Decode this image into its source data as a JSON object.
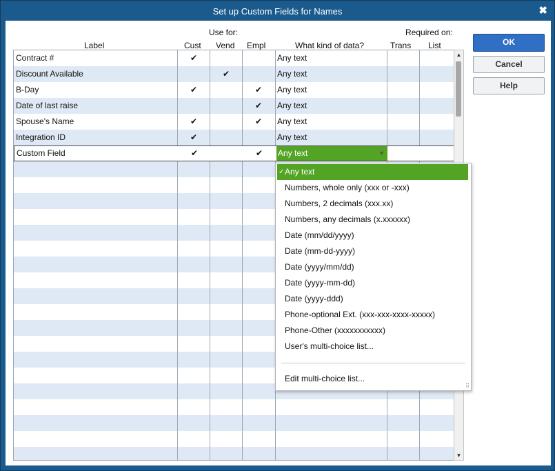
{
  "window": {
    "title": "Set up Custom Fields for Names",
    "close_glyph": "✖"
  },
  "headers": {
    "use_for": "Use for:",
    "required_on": "Required on:",
    "label": "Label",
    "cust": "Cust",
    "vend": "Vend",
    "empl": "Empl",
    "kind": "What kind of data?",
    "trans": "Trans",
    "list": "List"
  },
  "rows": [
    {
      "label": "Contract #",
      "cust": "✔",
      "vend": "",
      "empl": "",
      "kind": "Any text"
    },
    {
      "label": "Discount Available",
      "cust": "",
      "vend": "✔",
      "empl": "",
      "kind": "Any text"
    },
    {
      "label": "B-Day",
      "cust": "✔",
      "vend": "",
      "empl": "✔",
      "kind": "Any text"
    },
    {
      "label": "Date of last raise",
      "cust": "",
      "vend": "",
      "empl": "✔",
      "kind": "Any text"
    },
    {
      "label": "Spouse's Name",
      "cust": "✔",
      "vend": "",
      "empl": "✔",
      "kind": "Any text"
    },
    {
      "label": "Integration ID",
      "cust": "✔",
      "vend": "",
      "empl": "",
      "kind": "Any text"
    }
  ],
  "active_row": {
    "label": "Custom Field",
    "cust": "✔",
    "vend": "",
    "empl": "✔",
    "kind": "Any text",
    "arrow": "▼"
  },
  "dropdown": {
    "check": "✓",
    "options": [
      "Any text",
      "Numbers, whole only (xxx or -xxx)",
      "Numbers, 2 decimals (xxx.xx)",
      "Numbers, any decimals (x.xxxxxx)",
      "Date (mm/dd/yyyy)",
      "Date (mm-dd-yyyy)",
      "Date (yyyy/mm/dd)",
      "Date (yyyy-mm-dd)",
      "Date (yyyy-ddd)",
      "Phone-optional Ext. (xxx-xxx-xxxx-xxxxx)",
      "Phone-Other (xxxxxxxxxxx)",
      "User's multi-choice list..."
    ],
    "edit_option": "Edit multi-choice list...",
    "selected_index": 0
  },
  "buttons": {
    "ok": "OK",
    "cancel": "Cancel",
    "help": "Help"
  },
  "scrollbar": {
    "up": "▲",
    "down": "▼"
  },
  "colors": {
    "titlebar": "#1b5a8c",
    "selection_green": "#53a324",
    "row_stripe": "#dfe9f5",
    "primary_button": "#2f6fc4"
  }
}
